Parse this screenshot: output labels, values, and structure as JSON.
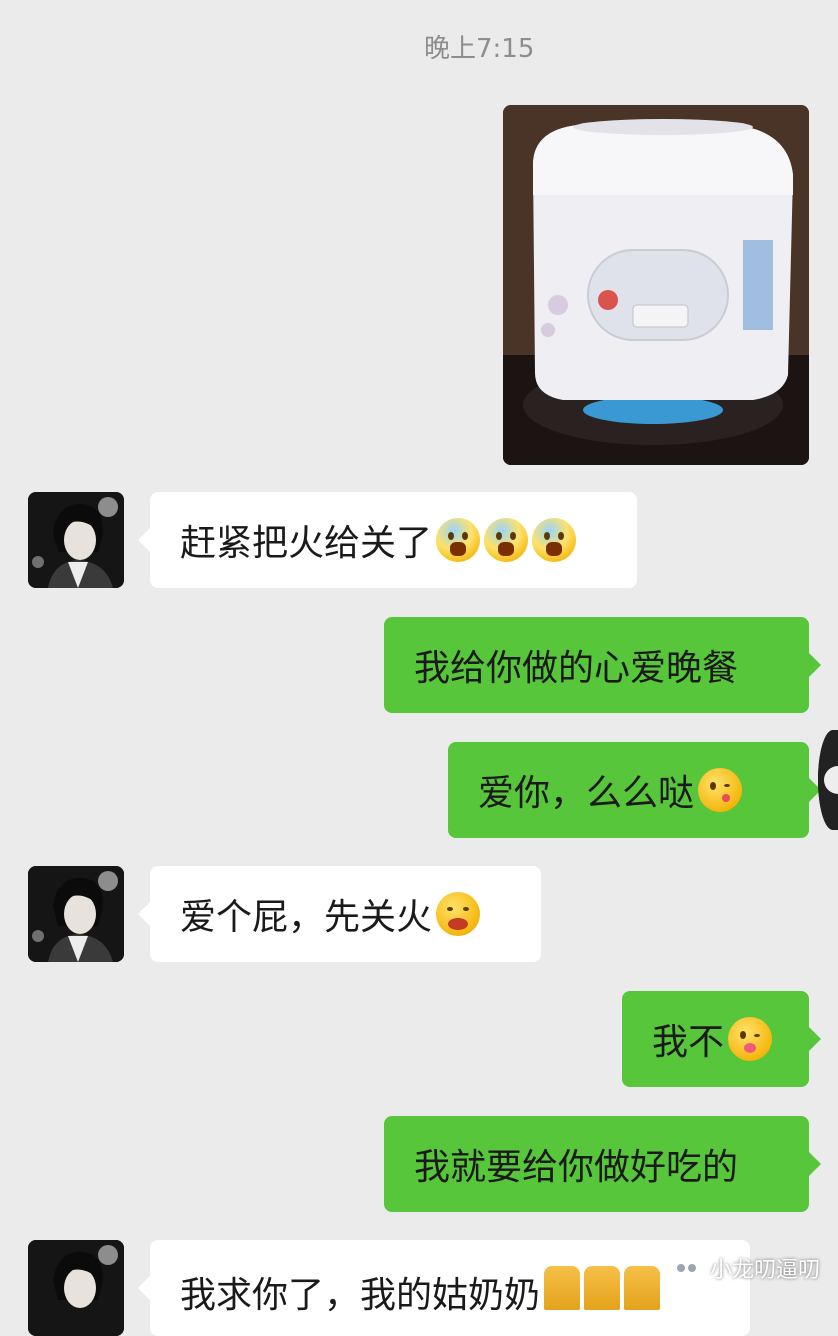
{
  "header": {
    "timestamp": "晚上7:15"
  },
  "messages": [
    {
      "side": "right",
      "type": "image",
      "alt": ""
    },
    {
      "side": "left",
      "text": "赶紧把火给关了",
      "emojis": [
        "scream-face",
        "scream-face",
        "scream-face"
      ]
    },
    {
      "side": "right",
      "text": "我给你做的心爱晚餐",
      "emojis": []
    },
    {
      "side": "right",
      "text": "爱你，么么哒",
      "emojis": [
        "kissing-face"
      ]
    },
    {
      "side": "left",
      "text": "爱个屁，先关火",
      "emojis": [
        "grinning-squint-face"
      ]
    },
    {
      "side": "right",
      "text": "我不",
      "emojis": [
        "winking-tongue-face"
      ]
    },
    {
      "side": "right",
      "text": "我就要给你做好吃的",
      "emojis": []
    },
    {
      "side": "left",
      "text": "我求你了，我的姑奶奶",
      "emojis": [
        "folded-hands",
        "folded-hands",
        "folded-hands"
      ]
    }
  ],
  "watermark": {
    "text": "小龙叨逼叨"
  },
  "colors": {
    "background": "#ebebeb",
    "bubble_left": "#ffffff",
    "bubble_right": "#58c63a",
    "timestamp": "#8d8d8d"
  }
}
